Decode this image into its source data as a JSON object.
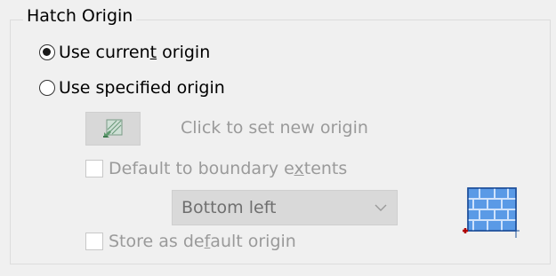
{
  "group": {
    "title": "Hatch Origin"
  },
  "options": {
    "use_current": {
      "label_pre": "Use curren",
      "label_u": "t",
      "label_post": " origin",
      "checked": true
    },
    "use_specified": {
      "label": "Use specified origin",
      "checked": false
    }
  },
  "set_origin": {
    "label": "Click to set new origin",
    "icon": "pick-origin-icon"
  },
  "default_boundary": {
    "label_pre": "Default to boundary e",
    "label_u": "x",
    "label_post": "tents",
    "checked": false
  },
  "position_select": {
    "value": "Bottom left"
  },
  "store_default": {
    "label_pre": "Store as de",
    "label_u": "f",
    "label_post": "ault origin",
    "checked": false
  },
  "colors": {
    "hatch_blue": "#2a6fc9",
    "origin_marker": "#b00000",
    "disabled_text": "#9a9a9a"
  }
}
